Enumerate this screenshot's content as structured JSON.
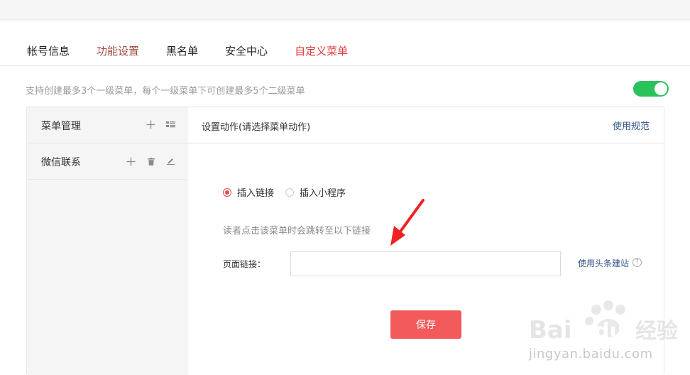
{
  "tabs": [
    {
      "label": "帐号信息",
      "state": "normal"
    },
    {
      "label": "功能设置",
      "state": "brown"
    },
    {
      "label": "黑名单",
      "state": "normal"
    },
    {
      "label": "安全中心",
      "state": "normal"
    },
    {
      "label": "自定义菜单",
      "state": "active"
    }
  ],
  "hint": "支持创建最多3个一级菜单，每个一级菜单下可创建最多5个二级菜单",
  "toggle": {
    "on": true,
    "color": "#2bc15b"
  },
  "menu": {
    "manage_label": "菜单管理",
    "items": [
      {
        "label": "微信联系"
      }
    ]
  },
  "action": {
    "title": "设置动作(请选择菜单动作)",
    "spec_link": "使用规范",
    "options": [
      {
        "label": "插入链接",
        "checked": true
      },
      {
        "label": "插入小程序",
        "checked": false
      }
    ],
    "redirect_hint": "读者点击该菜单时会跳转至以下链接",
    "url_label": "页面链接：",
    "url_value": "",
    "url_placeholder": "",
    "site_link": "使用头条建站",
    "help_glyph": "?",
    "save_label": "保存"
  },
  "watermark": {
    "text": "jingyan.baidu.com"
  },
  "colors": {
    "accent_red": "#f25a5b",
    "tab_active": "#e23a3a",
    "tab_brown": "#a04c40",
    "link_blue": "#35568a",
    "toggle_green": "#2bc15b"
  }
}
